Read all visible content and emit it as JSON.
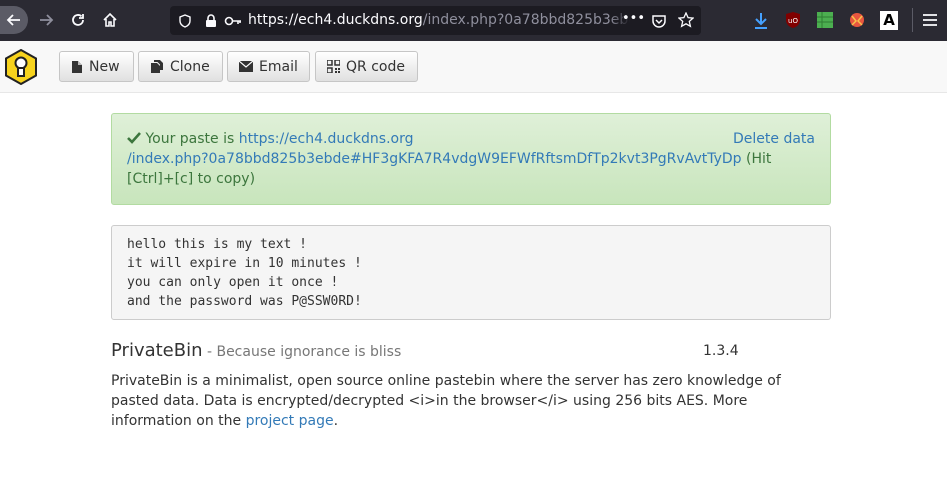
{
  "browser": {
    "url_host": "https://ech4.duckdns.org",
    "url_path": "/index.php?0a78bbd825b3ebde",
    "more_label": "•••"
  },
  "toolbar": {
    "new_label": "New",
    "clone_label": "Clone",
    "email_label": "Email",
    "qr_label": "QR code"
  },
  "alert": {
    "prefix": "Your paste is ",
    "link_line1": "https://ech4.duckdns.org",
    "link_line2": "/index.php?0a78bbd825b3ebde#HF3gKFA7R4vdgW9EFWfRftsmDfTp2kvt3PgRvAvtTyDp",
    "suffix_line2": " (Hit",
    "suffix_line3": "[Ctrl]+[c] to copy)",
    "delete_label": "Delete data"
  },
  "paste": {
    "lines": [
      "hello this is my text !",
      "it will expire in 10 minutes !",
      "you can only open it once !",
      "and the password was P@SSW0RD!"
    ]
  },
  "footer": {
    "brand": "PrivateBin",
    "tagline": " - Because ignorance is bliss",
    "version": "1.3.4",
    "about_text": "PrivateBin is a minimalist, open source online pastebin where the server has zero knowledge of pasted data. Data is encrypted/decrypted <i>in the browser</i> using 256 bits AES. More information on the ",
    "project_link": "project page",
    "period": "."
  },
  "colors": {
    "chrome": "#2b2a33",
    "alert_bg": "#dff0d8",
    "alert_text": "#3c763d",
    "link": "#337ab7",
    "logo_yellow": "#f7d31d"
  }
}
